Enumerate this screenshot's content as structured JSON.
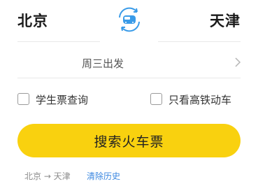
{
  "route": {
    "from": "北京",
    "to": "天津",
    "swap_icon": "train-swap-icon"
  },
  "date": {
    "label": "周三出发",
    "chevron_icon": "chevron-right-icon"
  },
  "options": {
    "student": {
      "label": "学生票查询",
      "checked": false
    },
    "high_speed_only": {
      "label": "只看高铁动车",
      "checked": false
    }
  },
  "search_button": {
    "label": "搜索火车票",
    "color": "#f9d10f"
  },
  "history": {
    "items": [
      "北京 → 天津"
    ],
    "clear_label": "清除历史",
    "clear_color": "#3b87e0"
  }
}
